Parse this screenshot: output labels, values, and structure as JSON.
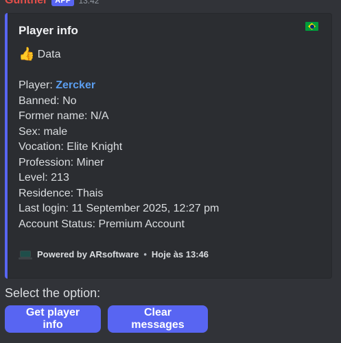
{
  "message": {
    "author": "Gunther",
    "badge": "APP",
    "time": "13:42"
  },
  "embed": {
    "title": "Player info",
    "flag_icon": "brazil-flag-icon",
    "subtitle_icon": "thumbs-up-icon",
    "subtitle": "Data",
    "fields": [
      {
        "label": "Player:",
        "value": "Zercker"
      },
      {
        "label": "Banned:",
        "value": "No"
      },
      {
        "label": "Former name:",
        "value": "N/A"
      },
      {
        "label": "Sex:",
        "value": "male"
      },
      {
        "label": "Vocation:",
        "value": "Elite Knight"
      },
      {
        "label": "Profession:",
        "value": "Miner"
      },
      {
        "label": "Level:",
        "value": "213"
      },
      {
        "label": "Residence:",
        "value": "Thais"
      },
      {
        "label": "Last login:",
        "value": "11 September 2025, 12:27 pm"
      },
      {
        "label": "Account Status:",
        "value": "Premium Account"
      }
    ],
    "footer_icon": "computer-icon",
    "footer_text": "Powered by ARsoftware",
    "footer_separator": "•",
    "footer_time": "Hoje às 13:46"
  },
  "components": {
    "prompt": "Select the option:",
    "buttons": [
      {
        "label": "Get player info"
      },
      {
        "label": "Clear messages"
      }
    ]
  },
  "colors": {
    "background": "#313338",
    "embed_background": "#2b2d31",
    "embed_accent": "#5865f2",
    "author": "#e44f4a",
    "link": "#5b9ef0",
    "button": "#5865f2"
  }
}
